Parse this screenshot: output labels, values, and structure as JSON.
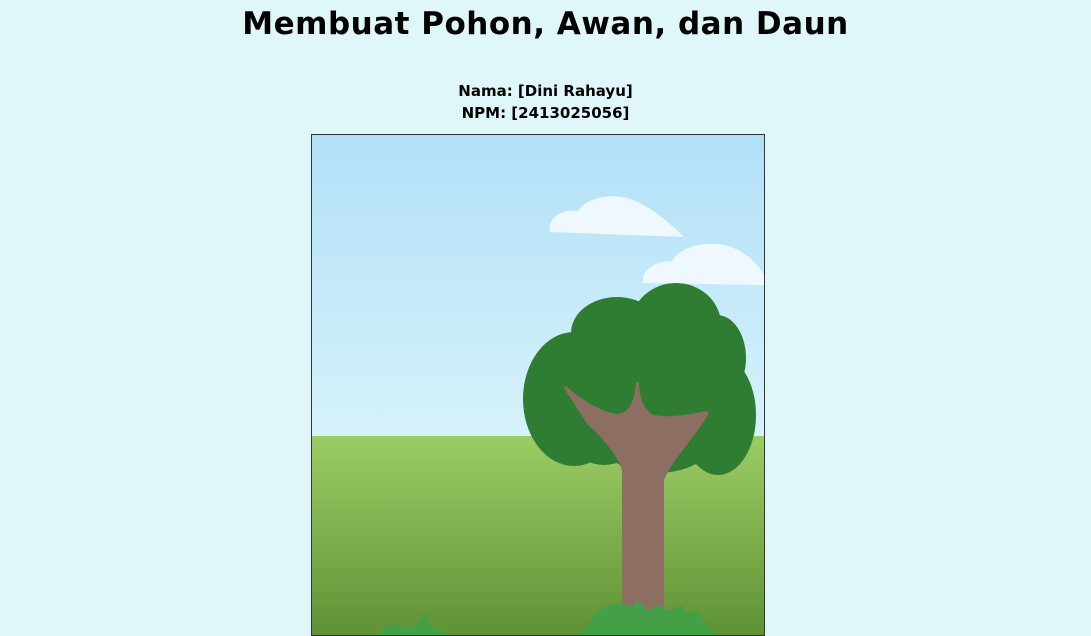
{
  "page": {
    "title": "Membuat Pohon, Awan, dan Daun",
    "name_line": "Nama: [Dini Rahayu]",
    "npm_line": "NPM: [2413025056]"
  },
  "colors": {
    "page_background": "#e0f7fa",
    "sky_top": "#b2e0f7",
    "sky_bottom": "#d6f2fb",
    "grass_top": "#9ccc65",
    "grass_bottom": "#689f38",
    "tree_foliage": "#2e7d32",
    "tree_trunk": "#8d6e63",
    "cloud": "#f0f8ff",
    "bush": "#43a047",
    "canvas_border": "#333333"
  }
}
